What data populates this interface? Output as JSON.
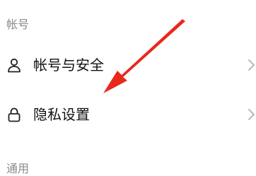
{
  "sections": [
    {
      "header": "帐号",
      "items": [
        {
          "label": "帐号与安全",
          "icon": "user-icon"
        },
        {
          "label": "隐私设置",
          "icon": "lock-icon"
        }
      ]
    },
    {
      "header": "通用"
    }
  ],
  "colors": {
    "annotation_arrow": "#e8291c",
    "section_header_text": "#8a8a8a",
    "item_text": "#111111",
    "chevron": "#b0b0b0"
  },
  "icons": {
    "row_chevron": "chevron-right-icon",
    "annotation": "red-arrow-icon"
  }
}
